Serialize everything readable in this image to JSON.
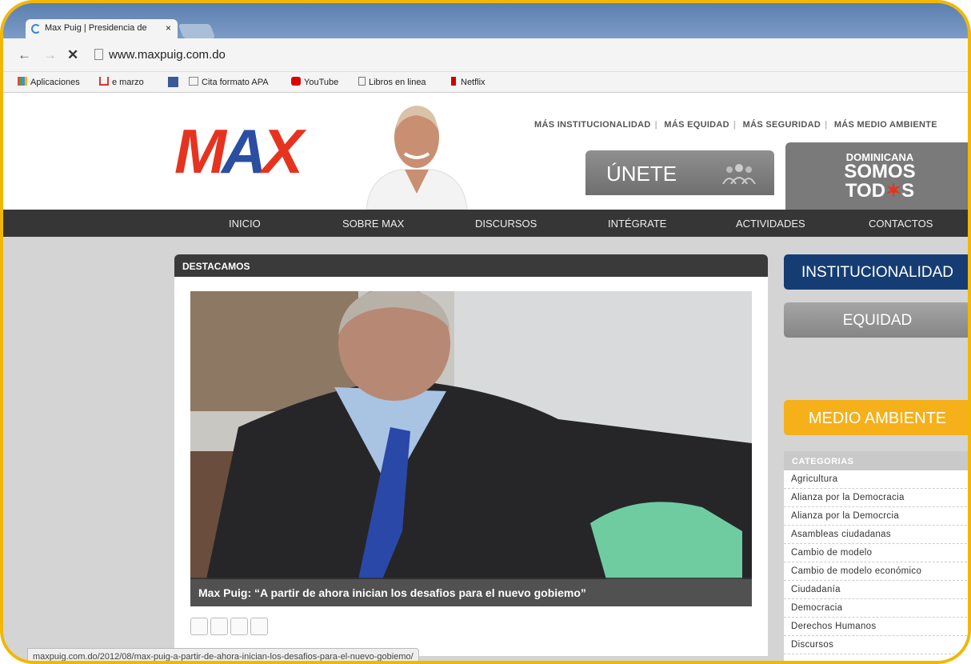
{
  "browser": {
    "tab_title": "Max Puig | Presidencia de",
    "tab_close": "×",
    "url": "www.maxpuig.com.do",
    "bookmarks": [
      "Aplicaciones",
      "e marzo",
      "Cita formato APA",
      "YouTube",
      "Libros en linea",
      "Netflix"
    ],
    "status_url": "maxpuig.com.do/2012/08/max-puig-a-partir-de-ahora-inician-los-desafios-para-el-nuevo-gobiemo/"
  },
  "header": {
    "logo": [
      "M",
      "A",
      "X"
    ],
    "top_links": [
      "MÁS INSTITUCIONALIDAD",
      "MÁS EQUIDAD",
      "MÁS SEGURIDAD",
      "MÁS MEDIO AMBIENTE"
    ],
    "unete": "ÚNETE",
    "somos": [
      "DOMINICANA",
      "SOMOS",
      "TOD",
      "S"
    ]
  },
  "nav": [
    "INICIO",
    "SOBRE MAX",
    "DISCURSOS",
    "INTÉGRATE",
    "ACTIVIDADES",
    "CONTACTOS"
  ],
  "featured": {
    "heading": "DESTACAMOS",
    "caption": "Max Puig: “A partir de ahora inician los desafios para el nuevo gobiemo”"
  },
  "sidebar": {
    "buttons": [
      "INSTITUCIONALIDAD",
      "EQUIDAD",
      "MEDIO AMBIENTE"
    ],
    "categories_title": "CATEGORIAS",
    "categories": [
      "Agricultura",
      "Alianza por la Democracia",
      "Alianza por la Democrcia",
      "Asambleas ciudadanas",
      "Cambio de modelo",
      "Cambio de modelo económico",
      "Ciudadanía",
      "Democracia",
      "Derechos Humanos",
      "Discursos"
    ]
  },
  "colors": {
    "accent_gold": "#f2b705",
    "nav_dark": "#363636",
    "institucionalidad": "#163d73",
    "medio_ambiente": "#f5b01a"
  }
}
